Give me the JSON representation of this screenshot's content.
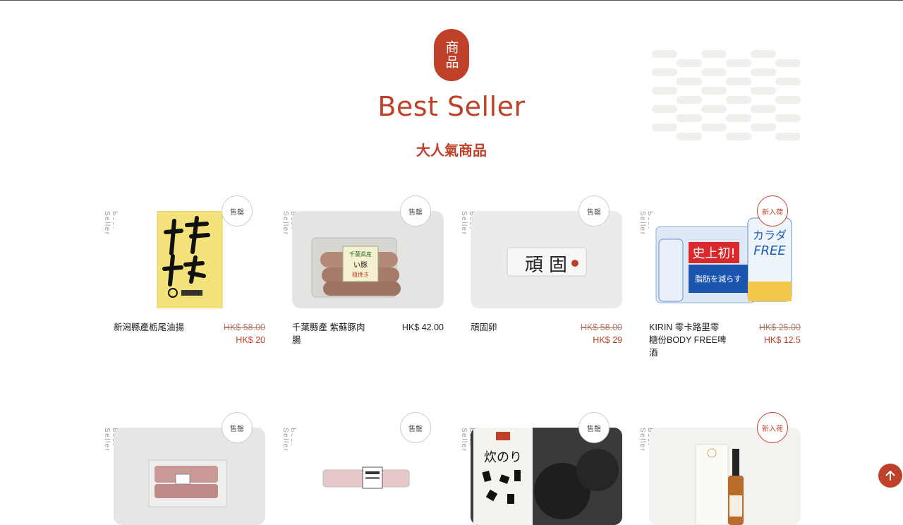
{
  "section": {
    "badge": "商品",
    "title": "Best Seller",
    "subtitle": "大人氣商品"
  },
  "colors": {
    "accent": "#c0412a",
    "pattern": "#efefeb"
  },
  "products": [
    {
      "side_label": "Best Seller",
      "tag": "售罄",
      "tag_type": "soldout",
      "name": "新潟縣產栃尾油揚",
      "old_price": "HK$ 58.00",
      "price": "HK$ 20",
      "image": "fried-tofu-package"
    },
    {
      "side_label": "Best Seller",
      "tag": "售罄",
      "tag_type": "soldout",
      "name": "千葉縣產 紫蘇豚肉腸",
      "old_price": "",
      "price": "HK$ 42.00",
      "image": "pork-sausage-package"
    },
    {
      "side_label": "Best Seller",
      "tag": "售罄",
      "tag_type": "soldout",
      "name": "頑固卵",
      "old_price": "HK$ 58.00",
      "price": "HK$ 29",
      "image": "egg-carton"
    },
    {
      "side_label": "Best Seller",
      "tag": "新入荷",
      "tag_type": "new",
      "name": "KIRIN 零卡路里零糖份BODY FREE啤酒",
      "old_price": "HK$ 25.00",
      "price": "HK$ 12.5",
      "image": "beer-cans"
    },
    {
      "side_label": "Best Seller",
      "tag": "售罄",
      "tag_type": "soldout",
      "name": "",
      "old_price": "",
      "price": "",
      "image": "meat-pack"
    },
    {
      "side_label": "Best Seller",
      "tag": "售罄",
      "tag_type": "soldout",
      "name": "",
      "old_price": "",
      "price": "",
      "image": "sausage-pack"
    },
    {
      "side_label": "Best Seller",
      "tag": "售罄",
      "tag_type": "soldout",
      "name": "",
      "old_price": "",
      "price": "",
      "image": "seaweed-box",
      "image_text": "炊のり"
    },
    {
      "side_label": "Best Seller",
      "tag": "新入荷",
      "tag_type": "new",
      "name": "",
      "old_price": "",
      "price": "",
      "image": "dropper-bottle"
    }
  ],
  "scroll_top": {
    "icon": "arrow-up-icon"
  }
}
